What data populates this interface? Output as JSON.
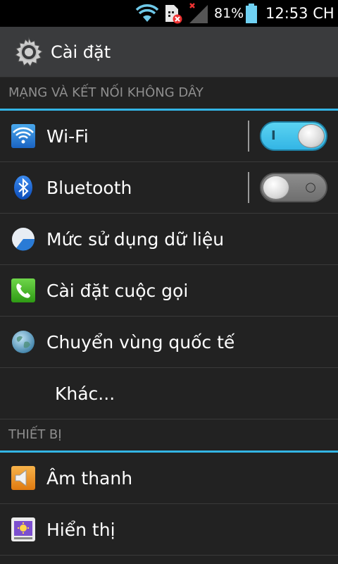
{
  "status_bar": {
    "battery_percent": "81%",
    "clock": "12:53 CH",
    "icons": [
      "wifi-signal-icon",
      "sim-error-icon",
      "cell-signal-none-icon",
      "battery-icon"
    ]
  },
  "action_bar": {
    "icon": "gear-icon",
    "title": "Cài đặt"
  },
  "sections": {
    "wireless": {
      "header": "MẠNG VÀ KẾT NỐI KHÔNG DÂY",
      "items": [
        {
          "icon": "wifi-icon",
          "label": "Wi-Fi",
          "toggle": "on"
        },
        {
          "icon": "bluetooth-icon",
          "label": "Bluetooth",
          "toggle": "off"
        },
        {
          "icon": "data-usage-icon",
          "label": "Mức sử dụng dữ liệu"
        },
        {
          "icon": "phone-icon",
          "label": "Cài đặt cuộc gọi"
        },
        {
          "icon": "globe-icon",
          "label": "Chuyển vùng quốc tế"
        },
        {
          "label": "Khác..."
        }
      ]
    },
    "device": {
      "header": "THIẾT BỊ",
      "items": [
        {
          "icon": "speaker-icon",
          "label": "Âm thanh"
        },
        {
          "icon": "display-icon",
          "label": "Hiển thị"
        }
      ]
    }
  },
  "colors": {
    "accent": "#33b5e5",
    "background": "#222222",
    "action_bar": "#3a3b3d",
    "status_bar": "#000000",
    "header_text": "#8e8e8e"
  }
}
